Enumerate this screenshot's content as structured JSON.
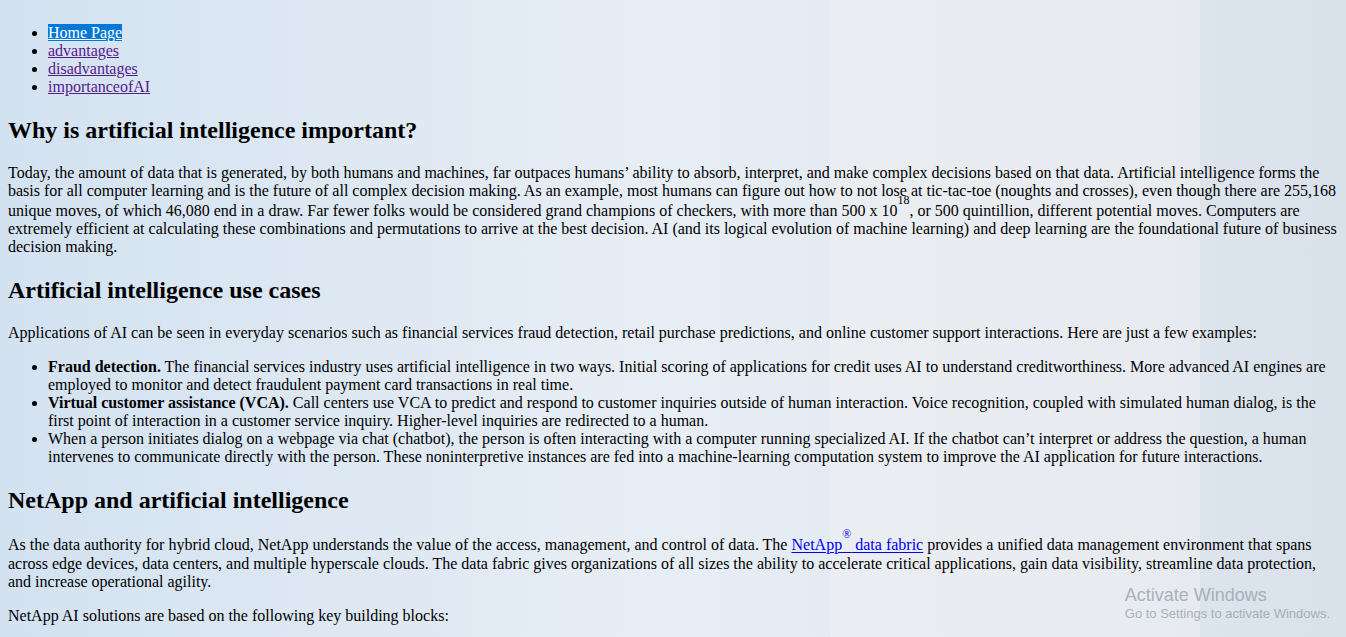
{
  "nav": [
    {
      "label": "Home Page",
      "selected": true
    },
    {
      "label": "advantages",
      "selected": false
    },
    {
      "label": "disadvantages",
      "selected": false
    },
    {
      "label": "importanceofAI",
      "selected": false
    }
  ],
  "blocks": [
    {
      "kind": "heading",
      "text": "Why is artificial intelligence important?"
    },
    {
      "kind": "paragraph",
      "parts": [
        {
          "kind": "text",
          "text": "Today, the amount of data that is generated, by both humans and machines, far outpaces humans’ ability to absorb, interpret, and make complex decisions based on that data. Artificial intelligence forms the basis for all computer learning and is the future of all complex decision making. As an example, most humans can figure out how to not lose at tic-tac-toe (noughts and crosses), even though there are 255,168 unique moves, of which 46,080 end in a draw. Far fewer folks would be considered grand champions of checkers, with more than 500 x 10"
        },
        {
          "kind": "sup",
          "text": "18"
        },
        {
          "kind": "text",
          "text": ", or 500 quintillion, different potential moves. Computers are extremely efficient at calculating these combinations and permutations to arrive at the best decision. AI (and its logical evolution of machine learning) and deep learning are the foundational future of business decision making."
        }
      ]
    },
    {
      "kind": "heading",
      "text": "Artificial intelligence use cases"
    },
    {
      "kind": "paragraph",
      "parts": [
        {
          "kind": "text",
          "text": "Applications of AI can be seen in everyday scenarios such as financial services fraud detection, retail purchase predictions, and online customer support interactions. Here are just a few examples:"
        }
      ]
    },
    {
      "kind": "list",
      "items": [
        {
          "label": "Fraud detection.",
          "text": " The financial services industry uses artificial intelligence in two ways. Initial scoring of applications for credit uses AI to understand creditworthiness. More advanced AI engines are employed to monitor and detect fraudulent payment card transactions in real time."
        },
        {
          "label": "Virtual customer assistance (VCA).",
          "text": " Call centers use VCA to predict and respond to customer inquiries outside of human interaction. Voice recognition, coupled with simulated human dialog, is the first point of interaction in a customer service inquiry. Higher-level inquiries are redirected to a human."
        },
        {
          "label": "",
          "text": "When a person initiates dialog on a webpage via chat (chatbot), the person is often interacting with a computer running specialized AI. If the chatbot can’t interpret or address the question, a human intervenes to communicate directly with the person. These noninterpretive instances are fed into a machine-learning computation system to improve the AI application for future interactions."
        }
      ]
    },
    {
      "kind": "heading",
      "text": "NetApp and artificial intelligence"
    },
    {
      "kind": "paragraph",
      "parts": [
        {
          "kind": "text",
          "text": "As the data authority for hybrid cloud, NetApp understands the value of the access, management, and control of data. The "
        },
        {
          "kind": "link",
          "text": "NetApp"
        },
        {
          "kind": "link-sup",
          "text": "®"
        },
        {
          "kind": "link",
          "text": " data fabric"
        },
        {
          "kind": "text",
          "text": " provides a unified data management environment that spans across edge devices, data centers, and multiple hyperscale clouds. The data fabric gives organizations of all sizes the ability to accelerate critical applications, gain data visibility, streamline data protection, and increase operational agility."
        }
      ]
    },
    {
      "kind": "paragraph",
      "parts": [
        {
          "kind": "text",
          "text": "NetApp AI solutions are based on the following key building blocks:"
        }
      ]
    }
  ],
  "watermark": {
    "title": "Activate Windows",
    "subtitle": "Go to Settings to activate Windows."
  }
}
